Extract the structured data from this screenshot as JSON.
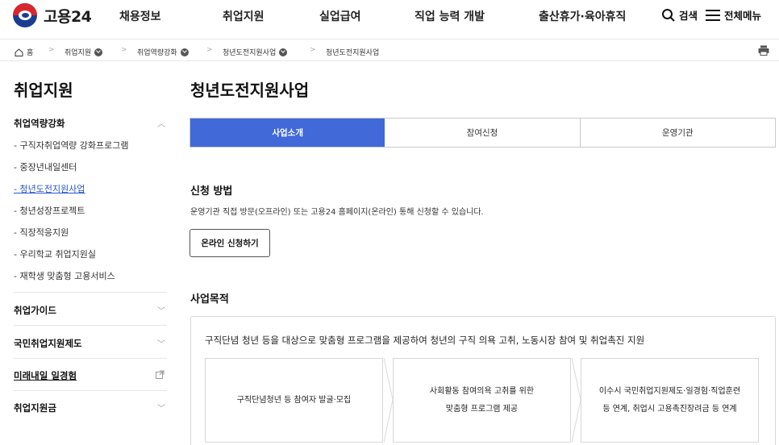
{
  "header": {
    "logo_text": "고용24",
    "nav": [
      "채용정보",
      "취업지원",
      "실업급여",
      "직업 능력 개발",
      "출산휴가·육아휴직"
    ],
    "search_label": "검색",
    "menu_label": "전체메뉴"
  },
  "breadcrumb": {
    "home": "홈",
    "items": [
      "취업지원",
      "취업역량강화",
      "청년도전지원사업",
      "청년도전지원사업"
    ]
  },
  "sidebar": {
    "title": "취업지원",
    "groups": [
      {
        "label": "취업역량강화",
        "expanded": true
      },
      {
        "label": "취업가이드"
      },
      {
        "label": "국민취업지원제도"
      },
      {
        "label": "미래내일 일경험"
      },
      {
        "label": "취업지원금"
      }
    ],
    "subitems": [
      "- 구직자취업역량 강화프로그램",
      "- 중장년내일센터",
      "- 청년도전지원사업",
      "- 청년성장프로젝트",
      "- 직장적응지원",
      "- 우리학교 취업지원실",
      "- 재학생 맞춤형 고용서비스"
    ],
    "active_subitem": "- 청년도전지원사업"
  },
  "main": {
    "title": "청년도전지원사업",
    "tabs": [
      "사업소개",
      "참여신청",
      "운영기관"
    ],
    "active_tab": "사업소개",
    "apply": {
      "heading": "신청 방법",
      "desc": "운영기관 직접 방문(오프라인) 또는 고용24 홈페이지(온라인) 통해 신청할 수 있습니다.",
      "button": "온라인 신청하기"
    },
    "purpose": {
      "heading": "사업목적",
      "text": "구직단념 청년 등을 대상으로 맞춤형 프로그램을 제공하여 청년의 구직 의욕 고취, 노동시장 참여 및 취업촉진 지원",
      "cards": [
        {
          "line1": "구직단념청년 등 참여자 발굴·모집",
          "line2": ""
        },
        {
          "line1": "사회활동 참여의욕 고취를 위한",
          "line2": "맞춤형 프로그램 제공"
        },
        {
          "line1": "이수시 국민취업지원제도·일경험·직업훈련",
          "line2": "등 연계, 취업시 고용촉진장려금 등 연계"
        }
      ]
    }
  },
  "colors": {
    "accent": "#4169d8",
    "link": "#2a56c6"
  }
}
